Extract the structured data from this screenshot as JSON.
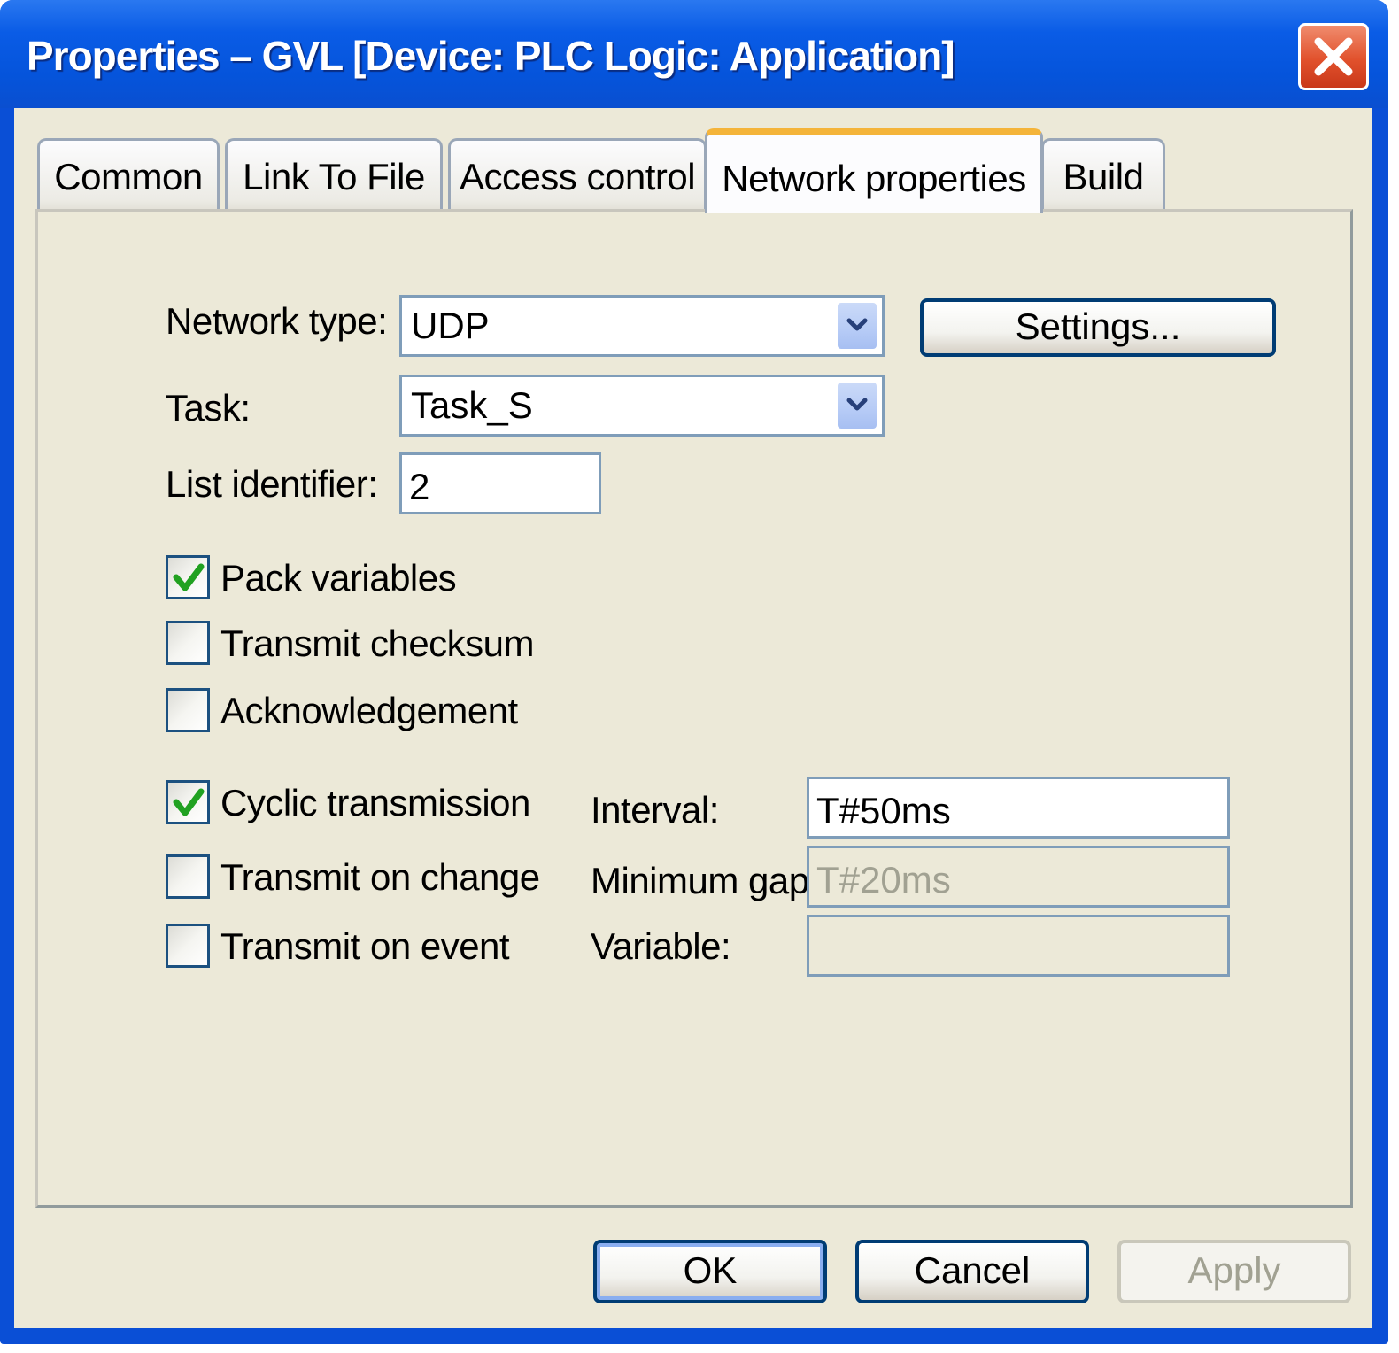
{
  "window": {
    "title": "Properties – GVL [Device: PLC Logic: Application]"
  },
  "tabs": [
    {
      "label": "Common"
    },
    {
      "label": "Link To File"
    },
    {
      "label": "Access control"
    },
    {
      "label": "Network properties",
      "active": true
    },
    {
      "label": "Build"
    }
  ],
  "form": {
    "network_type": {
      "label": "Network type:",
      "value": "UDP"
    },
    "settings_button": "Settings...",
    "task": {
      "label": "Task:",
      "value": "Task_S"
    },
    "list_identifier": {
      "label": "List identifier:",
      "value": "2"
    },
    "options": [
      {
        "label": "Pack variables",
        "checked": true
      },
      {
        "label": "Transmit checksum",
        "checked": false
      },
      {
        "label": "Acknowledgement",
        "checked": false
      }
    ],
    "transmission": [
      {
        "label": "Cyclic transmission",
        "checked": true
      },
      {
        "label": "Transmit on change",
        "checked": false
      },
      {
        "label": "Transmit on event",
        "checked": false
      }
    ],
    "interval": {
      "label": "Interval:",
      "value": "T#50ms"
    },
    "minimum_gap": {
      "label": "Minimum gap:",
      "value": "T#20ms",
      "enabled": false
    },
    "variable": {
      "label": "Variable:",
      "value": "",
      "enabled": false
    }
  },
  "buttons": {
    "ok": "OK",
    "cancel": "Cancel",
    "apply": "Apply"
  },
  "colors": {
    "titlebar": "#0554db",
    "client": "#ece9d8",
    "active_tab_accent": "#f4b43a",
    "check_mark": "#21a121",
    "close_button": "#e1512c"
  },
  "icons": {
    "close": "close-x-icon",
    "dropdown": "chevron-down-icon",
    "checkbox": "check-icon"
  }
}
